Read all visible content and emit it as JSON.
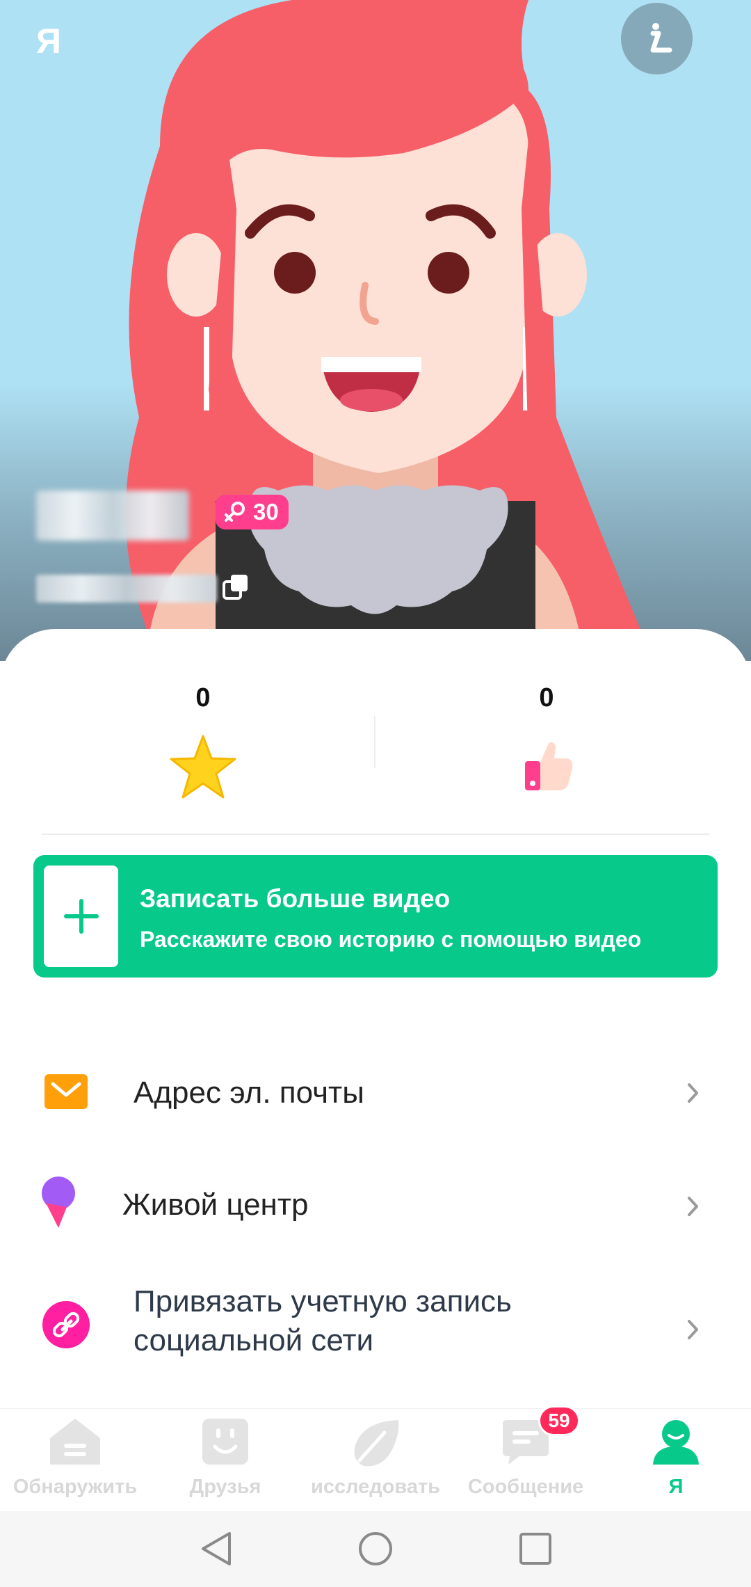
{
  "header": {
    "title": "Я"
  },
  "profile": {
    "age": "30"
  },
  "stats": [
    {
      "value": "0",
      "icon": "star-icon"
    },
    {
      "value": "0",
      "icon": "thumbs-up-icon"
    }
  ],
  "record_video": {
    "title": "Записать больше видео",
    "subtitle": "Расскажите свою историю с помощью видео"
  },
  "menu": [
    {
      "label": "Адрес эл. почты",
      "icon": "mail-icon"
    },
    {
      "label": "Живой центр",
      "icon": "microphone-icon"
    },
    {
      "label_line1": "Привязать учетную запись",
      "label_line2": "социальной сети",
      "icon": "link-icon"
    }
  ],
  "nav": [
    {
      "label": "Обнаружить",
      "icon": "discover-icon"
    },
    {
      "label": "Друзья",
      "icon": "friends-icon"
    },
    {
      "label": "исследовать",
      "icon": "explore-icon"
    },
    {
      "label": "Сообщение",
      "icon": "message-icon",
      "badge": "59"
    },
    {
      "label": "Я",
      "icon": "profile-icon",
      "active": true
    }
  ],
  "colors": {
    "accent": "#06c98a",
    "badge": "#ff2a5a",
    "gender_badge": "#ff3f8e",
    "hair": "#f65e68"
  }
}
